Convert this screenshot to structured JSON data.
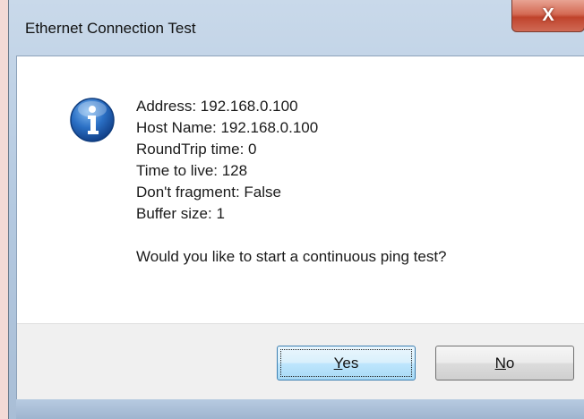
{
  "window": {
    "title": "Ethernet Connection Test",
    "close_glyph": "X"
  },
  "message": {
    "icon": "info-icon",
    "lines": [
      "Address: 192.168.0.100",
      "Host Name: 192.168.0.100",
      "RoundTrip time: 0",
      "Time to live: 128",
      "Don't fragment: False",
      "Buffer size: 1"
    ],
    "question": "Would you like to start a continuous ping test?"
  },
  "buttons": {
    "yes": {
      "mnemonic": "Y",
      "rest": "es"
    },
    "no": {
      "mnemonic": "N",
      "rest": "o"
    }
  },
  "colors": {
    "accent": "#3c7fb1",
    "close": "#c0432c"
  }
}
